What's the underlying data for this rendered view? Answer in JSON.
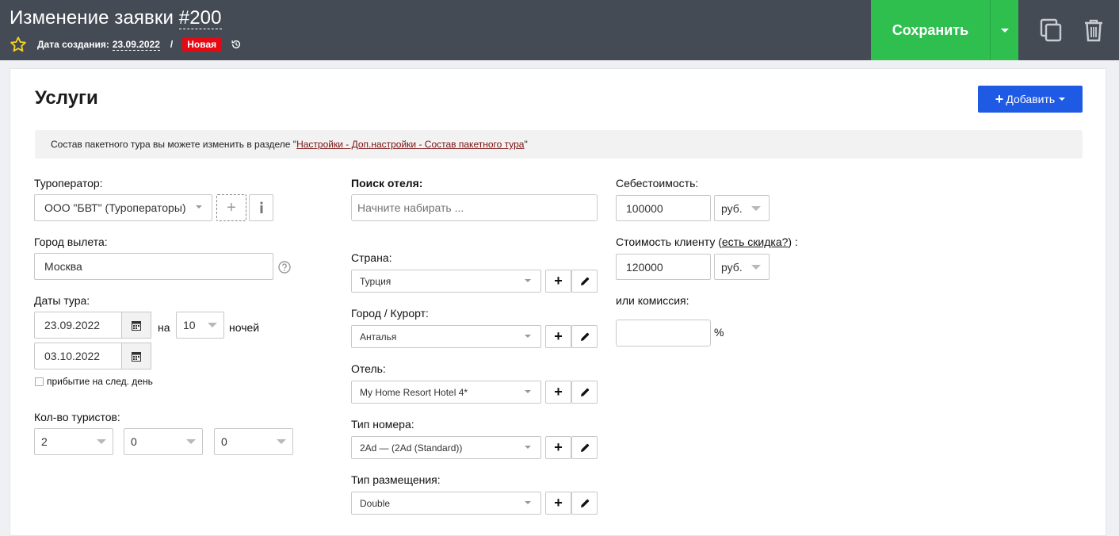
{
  "header": {
    "title_prefix": "Изменение заявки ",
    "title_number": "#200",
    "created_label": "Дата создания:",
    "created_date": "23.09.2022",
    "separator": "/",
    "status": "Новая",
    "save_label": "Сохранить",
    "icons": [
      "star-icon",
      "history-icon",
      "chevron-down-icon",
      "copy-icon",
      "trash-icon"
    ],
    "colors": {
      "bar": "#454b55",
      "save": "#2ebf4f",
      "status": "#e50914"
    }
  },
  "section": {
    "title": "Услуги",
    "add_label": "Добавить",
    "notice_text": "Состав пакетного тура вы можете изменить в разделе \"",
    "notice_link": "Настройки - Доп.настройки - Состав пакетного тура",
    "notice_end": "\""
  },
  "left": {
    "operator_label": "Туроператор:",
    "operator_value": "ООО \"БВТ\" (Туроператоры)",
    "add_symbol": "+",
    "info_icon": "info-icon",
    "city_label": "Город вылета:",
    "city_value": "Москва",
    "help_icon": "question-icon",
    "dates_label": "Даты тура:",
    "date_from": "23.09.2022",
    "on_label": "на",
    "nights_value": "10",
    "nights_label": "ночей",
    "date_to": "03.10.2022",
    "arrival_label": "прибытие на след. день",
    "tourists_label": "Кол-во туристов:",
    "tourists": [
      "2",
      "0",
      "0"
    ]
  },
  "middle": {
    "search_label": "Поиск отеля:",
    "search_placeholder": "Начните набирать ...",
    "country_label": "Страна:",
    "country_value": "Турция",
    "resort_label": "Город / Курорт:",
    "resort_value": "Анталья",
    "hotel_label": "Отель:",
    "hotel_value": "My Home Resort Hotel 4*",
    "room_label": "Тип номера:",
    "room_value": "2Ad — (2Ad (Standard))",
    "accom_label": "Тип размещения:",
    "accom_value": "Double"
  },
  "right": {
    "cost_label": "Себестоимость:",
    "cost_value": "100000",
    "currency": "руб.",
    "client_label_a": "Стоимость клиенту (",
    "client_link": "есть скидка?",
    "client_label_b": ") :",
    "client_value": "120000",
    "commission_label": "или комиссия:",
    "commission_value": "",
    "percent": "%"
  }
}
